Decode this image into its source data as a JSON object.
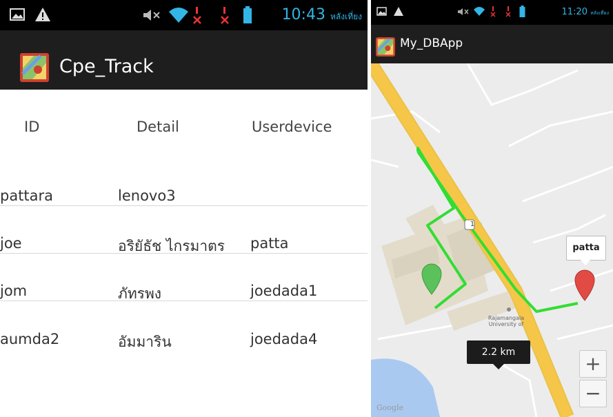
{
  "left": {
    "statusbar": {
      "time": "10:43",
      "time_suffix": "หลังเที่ยง"
    },
    "app_title": "Cpe_Track",
    "table": {
      "headers": [
        "ID",
        "Detail",
        "Userdevice"
      ],
      "rows": [
        [
          "pattara",
          "lenovo3",
          ""
        ],
        [
          "joe",
          "อริยัธัช ไกรมาตร",
          "patta"
        ],
        [
          "jom",
          "ภัทรพง",
          "joedada1"
        ],
        [
          "aumda2",
          "อัมมาริน",
          "joedada4"
        ]
      ]
    }
  },
  "right": {
    "statusbar": {
      "time": "11:20",
      "time_suffix": "หลังเที่ยง"
    },
    "app_title": "My_DBApp",
    "map": {
      "marker_label": "patta",
      "distance": "2.2 km",
      "zoom_in": "+",
      "zoom_out": "−",
      "place_label": "Rajamangala University of",
      "watermark": "Google",
      "road_badge": "1",
      "colors": {
        "route": "#33dd33",
        "road": "#f6c648",
        "water": "#a9c9f0",
        "marker_red": "#e24b43",
        "marker_green": "#5bc25b"
      }
    }
  }
}
